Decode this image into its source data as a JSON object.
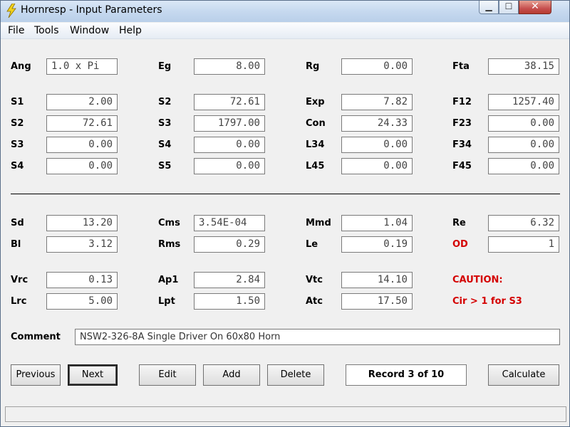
{
  "window": {
    "title": "Hornresp - Input Parameters"
  },
  "menu": [
    "File",
    "Tools",
    "Window",
    "Help"
  ],
  "params": {
    "ang": {
      "label": "Ang",
      "value": "1.0 x Pi"
    },
    "eg": {
      "label": "Eg",
      "value": "8.00"
    },
    "rg": {
      "label": "Rg",
      "value": "0.00"
    },
    "fta": {
      "label": "Fta",
      "value": "38.15"
    },
    "s1": {
      "label": "S1",
      "value": "2.00"
    },
    "s2a": {
      "label": "S2",
      "value": "72.61"
    },
    "exp": {
      "label": "Exp",
      "value": "7.82"
    },
    "f12": {
      "label": "F12",
      "value": "1257.40"
    },
    "s2b": {
      "label": "S2",
      "value": "72.61"
    },
    "s3a": {
      "label": "S3",
      "value": "1797.00"
    },
    "con": {
      "label": "Con",
      "value": "24.33"
    },
    "f23": {
      "label": "F23",
      "value": "0.00"
    },
    "s3b": {
      "label": "S3",
      "value": "0.00"
    },
    "s4a": {
      "label": "S4",
      "value": "0.00"
    },
    "l34": {
      "label": "L34",
      "value": "0.00"
    },
    "f34": {
      "label": "F34",
      "value": "0.00"
    },
    "s4b": {
      "label": "S4",
      "value": "0.00"
    },
    "s5": {
      "label": "S5",
      "value": "0.00"
    },
    "l45": {
      "label": "L45",
      "value": "0.00"
    },
    "f45": {
      "label": "F45",
      "value": "0.00"
    },
    "sd": {
      "label": "Sd",
      "value": "13.20"
    },
    "cms": {
      "label": "Cms",
      "value": "3.54E-04"
    },
    "mmd": {
      "label": "Mmd",
      "value": "1.04"
    },
    "re": {
      "label": "Re",
      "value": "6.32"
    },
    "bl": {
      "label": "Bl",
      "value": "3.12"
    },
    "rms": {
      "label": "Rms",
      "value": "0.29"
    },
    "le": {
      "label": "Le",
      "value": "0.19"
    },
    "od": {
      "label": "OD",
      "value": "1"
    },
    "vrc": {
      "label": "Vrc",
      "value": "0.13"
    },
    "ap1": {
      "label": "Ap1",
      "value": "2.84"
    },
    "vtc": {
      "label": "Vtc",
      "value": "14.10"
    },
    "lrc": {
      "label": "Lrc",
      "value": "5.00"
    },
    "lpt": {
      "label": "Lpt",
      "value": "1.50"
    },
    "atc": {
      "label": "Atc",
      "value": "17.50"
    }
  },
  "caution": {
    "title": "CAUTION:",
    "message": "Cir > 1 for S3",
    "color": "#d40000"
  },
  "comment": {
    "label": "Comment",
    "value": "NSW2-326-8A Single Driver On 60x80 Horn"
  },
  "buttons": {
    "previous": "Previous",
    "next": "Next",
    "edit": "Edit",
    "add": "Add",
    "delete": "Delete",
    "calculate": "Calculate"
  },
  "record": "Record 3 of 10",
  "icons": {
    "app": "lightning-bolt-icon",
    "minimize": "minimize-icon",
    "maximize": "maximize-icon",
    "close": "close-icon"
  }
}
